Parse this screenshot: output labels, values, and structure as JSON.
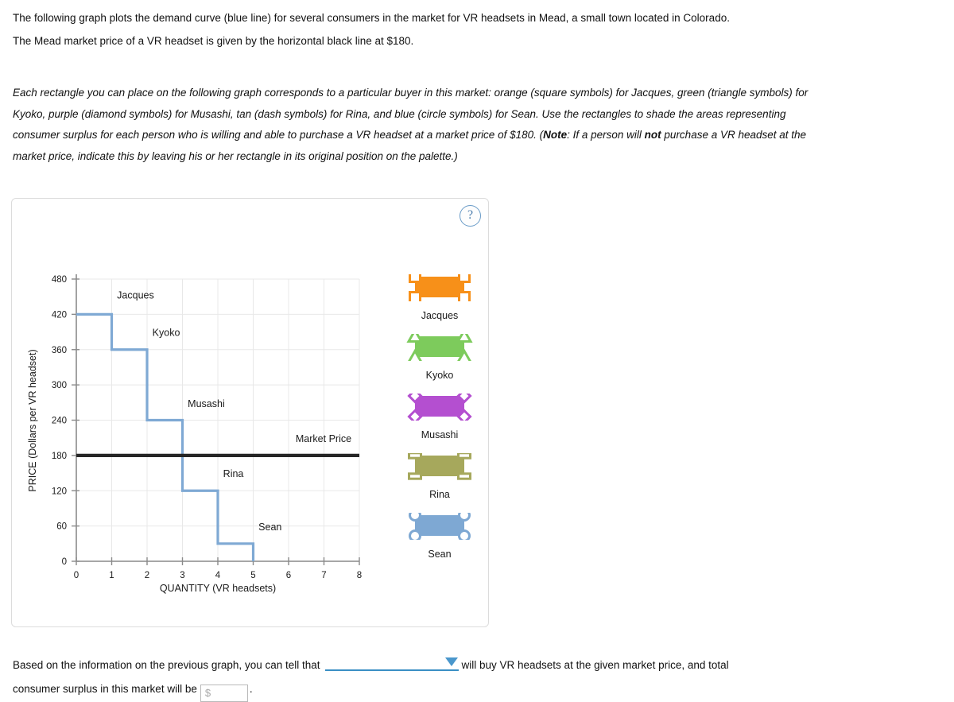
{
  "intro": {
    "line1": "The following graph plots the demand curve (blue line) for several consumers in the market for VR headsets in Mead, a small town located in Colorado.",
    "line2": "The Mead market price of a VR headset is given by the horizontal black line at $180."
  },
  "instructions": {
    "part1": "Each rectangle you can place on the following graph corresponds to a particular buyer in this market: orange (square symbols) for Jacques, green (triangle symbols) for Kyoko, purple (diamond symbols) for Musashi, tan (dash symbols) for Rina, and blue (circle symbols) for Sean. Use the rectangles to shade the areas representing consumer surplus for each person who is willing and able to purchase a VR headset at a market price of $180. (",
    "note_label": "Note",
    "part2": ": If a person will ",
    "not_label": "not",
    "part3": " purchase a VR headset at the market price, indicate this by leaving his or her rectangle in its original position on the palette.)"
  },
  "graph_panel": {
    "help_icon_label": "?"
  },
  "chart_data": {
    "type": "line",
    "title": "",
    "xlabel": "QUANTITY (VR headsets)",
    "ylabel": "PRICE (Dollars per VR headset)",
    "xlim": [
      0,
      8
    ],
    "ylim": [
      0,
      480
    ],
    "xticks": [
      "0",
      "1",
      "2",
      "3",
      "4",
      "5",
      "6",
      "7",
      "8"
    ],
    "yticks": [
      "0",
      "60",
      "120",
      "180",
      "240",
      "300",
      "360",
      "420",
      "480"
    ],
    "grid": true,
    "legend": "none",
    "series": [
      {
        "name": "Demand",
        "color": "#7fa9d4",
        "type": "step",
        "steps": [
          {
            "buyer": "Jacques",
            "x_start": 0,
            "x_end": 1,
            "value": 420
          },
          {
            "buyer": "Kyoko",
            "x_start": 1,
            "x_end": 2,
            "value": 360
          },
          {
            "buyer": "Musashi",
            "x_start": 2,
            "x_end": 3,
            "value": 240
          },
          {
            "buyer": "Rina",
            "x_start": 3,
            "x_end": 4,
            "value": 120
          },
          {
            "buyer": "Sean",
            "x_start": 4,
            "x_end": 5,
            "value": 30
          }
        ]
      },
      {
        "name": "Market Price",
        "color": "#262626",
        "type": "hline",
        "value": 180,
        "x_start": 0,
        "x_end": 8
      }
    ],
    "annotations": [
      {
        "text": "Jacques",
        "x": 1.15,
        "y": 447
      },
      {
        "text": "Kyoko",
        "x": 2.15,
        "y": 383
      },
      {
        "text": "Musashi",
        "x": 3.15,
        "y": 262
      },
      {
        "text": "Market Price",
        "x": 6.2,
        "y": 203
      },
      {
        "text": "Rina",
        "x": 4.15,
        "y": 143
      },
      {
        "text": "Sean",
        "x": 5.15,
        "y": 53
      }
    ]
  },
  "palette": {
    "items": [
      {
        "label": "Jacques",
        "color": "#F79019",
        "handle": "square"
      },
      {
        "label": "Kyoko",
        "color": "#7DCB5C",
        "handle": "triangle"
      },
      {
        "label": "Musashi",
        "color": "#B44FD0",
        "handle": "diamond"
      },
      {
        "label": "Rina",
        "color": "#A6A85C",
        "handle": "dash"
      },
      {
        "label": "Sean",
        "color": "#7EA8D3",
        "handle": "circle"
      }
    ]
  },
  "bottom_question": {
    "text_before_dropdown": "Based on the information on the previous graph, you can tell that",
    "dropdown_value": "",
    "text_after_dropdown": "will buy VR headsets at the given market price, and total",
    "text_line2": "consumer surplus in this market will be",
    "money_placeholder": "$",
    "money_value": "",
    "period": "."
  }
}
